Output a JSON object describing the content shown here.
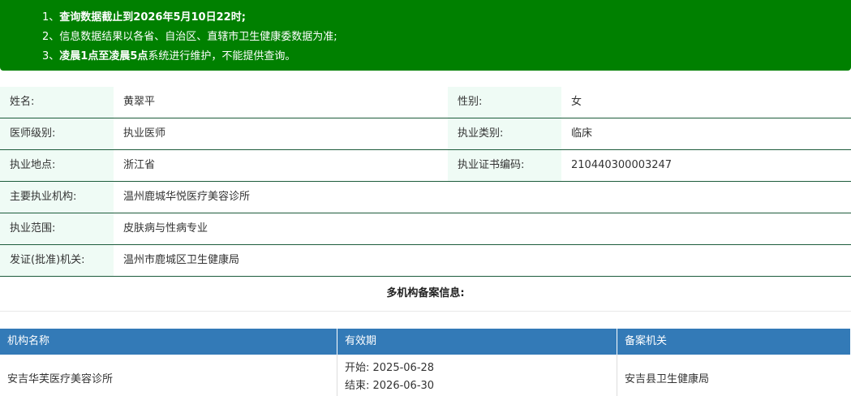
{
  "notice": {
    "line1_prefix": "1、",
    "line1_bold": "查询数据截止到2026年5月10日22时;",
    "line2": "2、信息数据结果以各省、自治区、直辖市卫生健康委数据为准;",
    "line3_prefix": "3、",
    "line3_bold": "凌晨1点至凌晨5点",
    "line3_suffix": "系统进行维护，不能提供查询。"
  },
  "info": {
    "name_label": "姓名:",
    "name_value": "黄翠平",
    "gender_label": "性别:",
    "gender_value": "女",
    "level_label": "医师级别:",
    "level_value": "执业医师",
    "category_label": "执业类别:",
    "category_value": "临床",
    "location_label": "执业地点:",
    "location_value": "浙江省",
    "cert_label": "执业证书编码:",
    "cert_value": "210440300003247",
    "org_label": "主要执业机构:",
    "org_value": "温州鹿城华悦医疗美容诊所",
    "scope_label": "执业范围:",
    "scope_value": "皮肤病与性病专业",
    "issuer_label": "发证(批准)机关:",
    "issuer_value": "温州市鹿城区卫生健康局"
  },
  "multi": {
    "title": "多机构备案信息:",
    "columns": [
      "机构名称",
      "有效期",
      "备案机关"
    ],
    "rows": [
      {
        "name": "安吉华芙医疗美容诊所",
        "start": "开始: 2025-06-28",
        "end": "结束: 2026-06-30",
        "authority": "安吉县卫生健康局"
      }
    ]
  },
  "colors": {
    "notice_bg": "#008000",
    "label_bg": "#effbf5",
    "row_border": "#1d5c3c",
    "table_header_bg": "#337ab7"
  }
}
